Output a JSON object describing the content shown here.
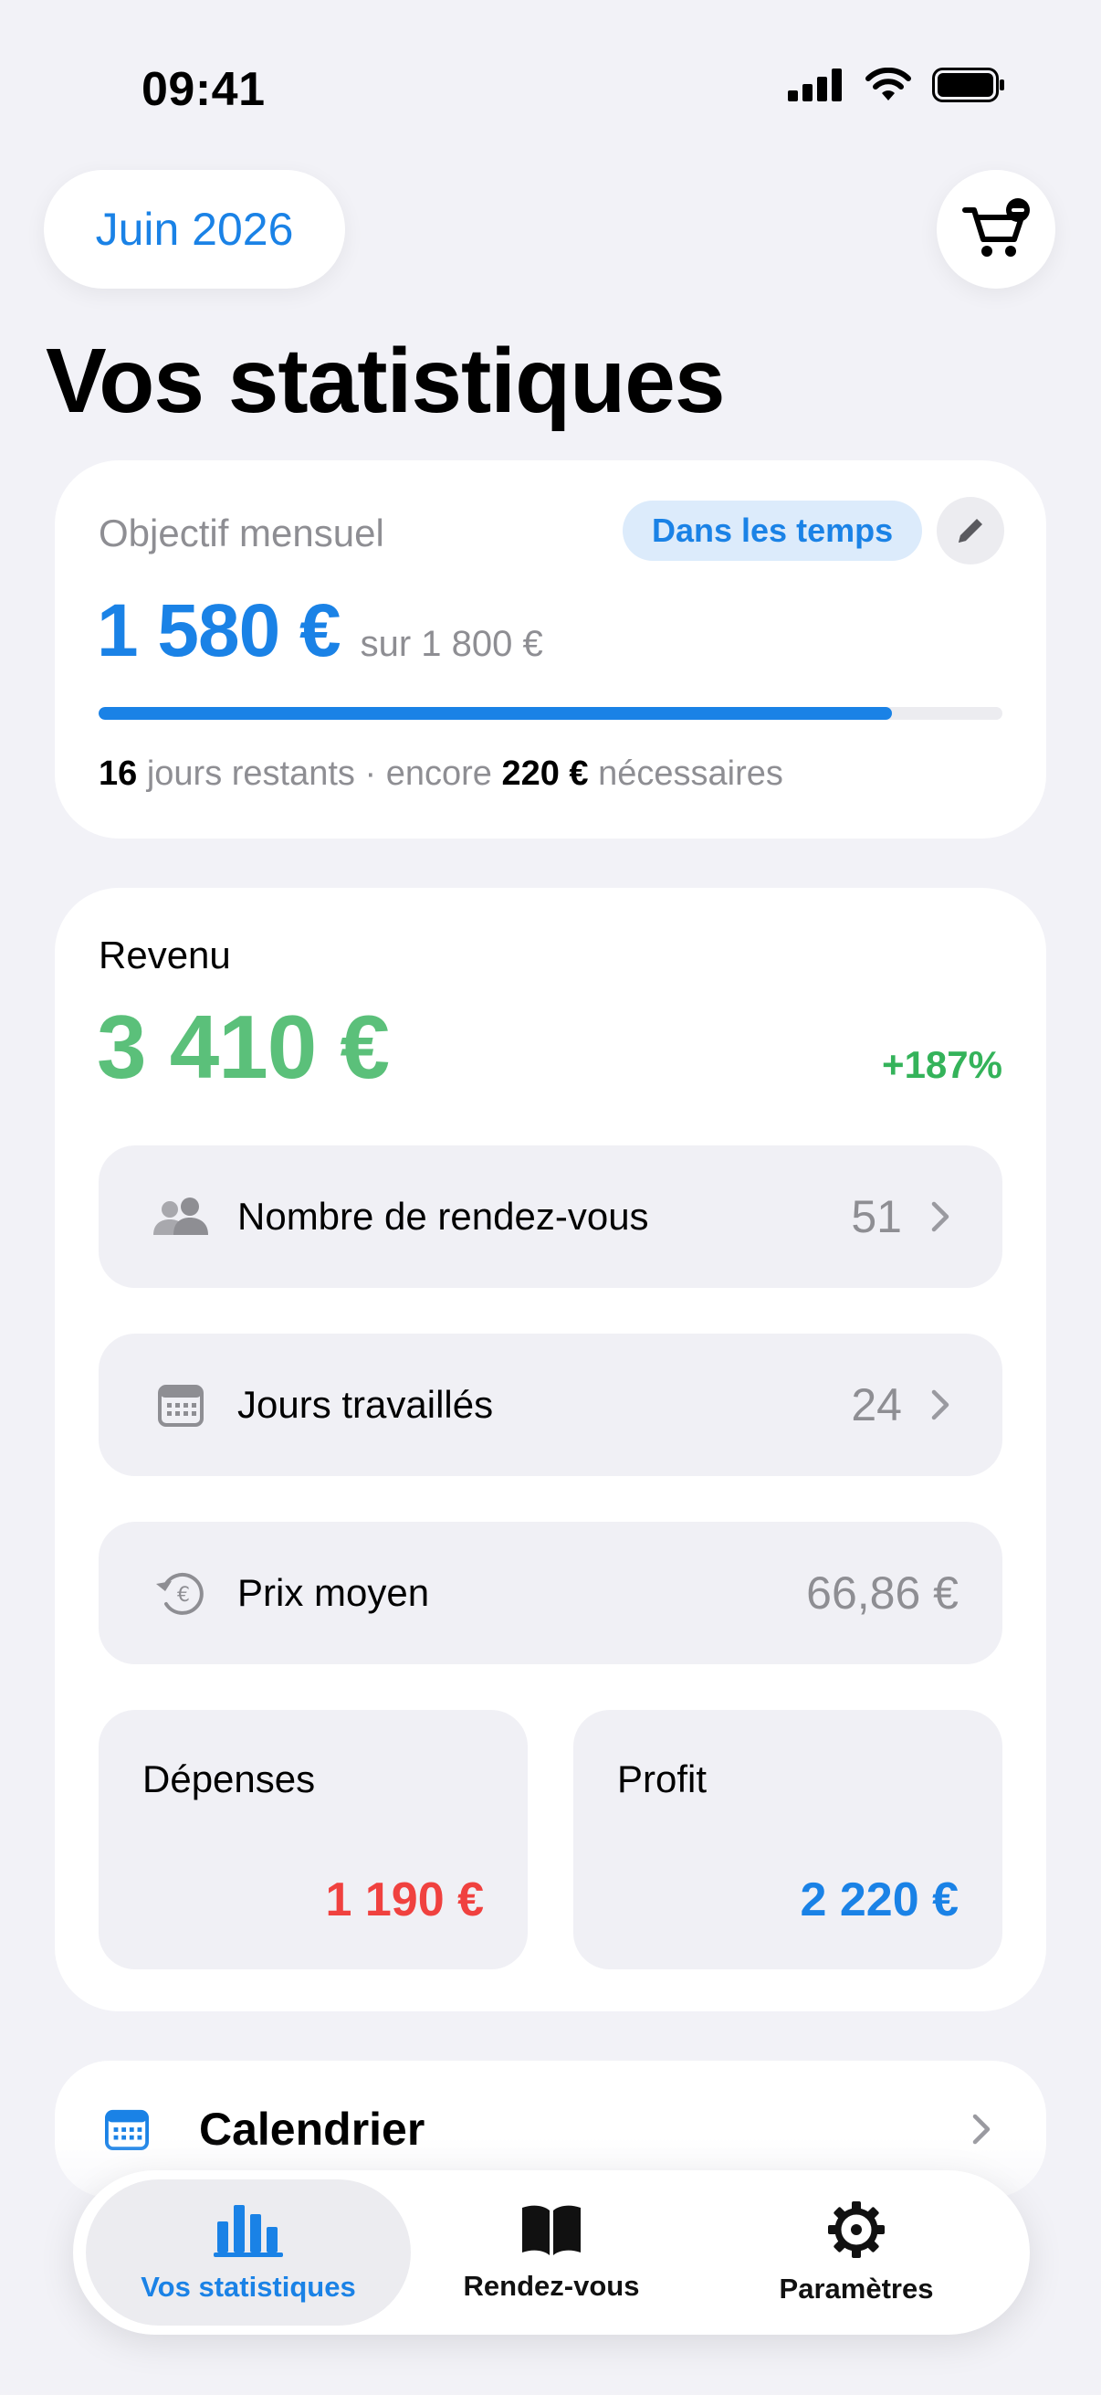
{
  "status_bar": {
    "time": "09:41"
  },
  "header": {
    "month": "Juin 2026",
    "title": "Vos statistiques"
  },
  "goal": {
    "label": "Objectif mensuel",
    "badge": "Dans les temps",
    "current": "1 580 €",
    "target": "sur 1 800 €",
    "progress": 0.878,
    "days_left": "16",
    "days_left_text": "jours restants · encore",
    "needed": "220 €",
    "needed_text": "nécessaires"
  },
  "revenue": {
    "label": "Revenu",
    "amount": "3 410 €",
    "change": "+187%",
    "rows": [
      {
        "label": "Nombre de rendez-vous",
        "value": "51",
        "icon": "people-icon"
      },
      {
        "label": "Jours travaillés",
        "value": "24",
        "icon": "calendar-icon"
      },
      {
        "label": "Prix moyen",
        "value": "66,86 €",
        "icon": "euro-cycle-icon"
      }
    ],
    "expenses": {
      "label": "Dépenses",
      "value": "1 190 €"
    },
    "profit": {
      "label": "Profit",
      "value": "2 220 €"
    }
  },
  "calendar": {
    "title": "Calendrier"
  },
  "tabs": [
    {
      "label": "Vos statistiques",
      "icon": "bar-chart-icon",
      "active": true
    },
    {
      "label": "Rendez-vous",
      "icon": "book-icon",
      "active": false
    },
    {
      "label": "Paramètres",
      "icon": "gear-icon",
      "active": false
    }
  ],
  "colors": {
    "accent": "#1a82e6",
    "positive": "#5bc07a",
    "negative": "#f0413f",
    "background": "#f2f2f7"
  }
}
